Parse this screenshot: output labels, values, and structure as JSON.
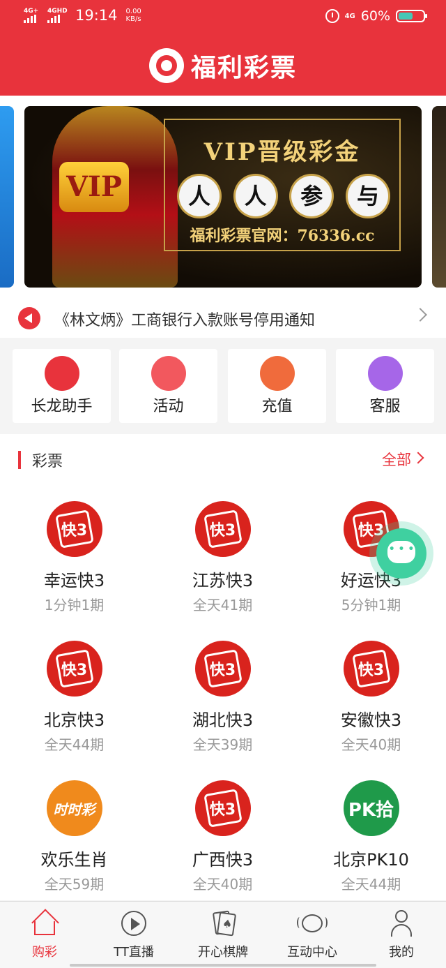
{
  "status_bar": {
    "signal1": "4G+",
    "signal2": "4GHD",
    "time": "19:14",
    "speed_value": "0.00",
    "speed_unit": "KB/s",
    "network": "4G",
    "battery": "60%"
  },
  "header": {
    "title": "福利彩票"
  },
  "banner": {
    "vip_badge": "VIP",
    "title": "VIP晋级彩金",
    "circles": [
      "人",
      "人",
      "参",
      "与"
    ],
    "subtitle": "福利彩票官网：76336.cc"
  },
  "notice": {
    "text": "《林文炳》工商银行入款账号停用通知"
  },
  "quick_actions": [
    {
      "label": "长龙助手",
      "icon": "dragon-icon",
      "color": "#e8333c"
    },
    {
      "label": "活动",
      "icon": "gift-icon",
      "color": "#f2585e"
    },
    {
      "label": "充值",
      "icon": "wallet-icon",
      "color": "#f06b3c"
    },
    {
      "label": "客服",
      "icon": "headset-icon",
      "color": "#a666e8"
    }
  ],
  "lottery_section": {
    "title": "彩票",
    "all_label": "全部",
    "games": [
      {
        "name": "幸运快3",
        "schedule": "1分钟1期",
        "icon": "k3-icon",
        "icon_text": "快3"
      },
      {
        "name": "江苏快3",
        "schedule": "全天41期",
        "icon": "k3-icon",
        "icon_text": "快3"
      },
      {
        "name": "好运快3",
        "schedule": "5分钟1期",
        "icon": "k3-icon",
        "icon_text": "快3"
      },
      {
        "name": "北京快3",
        "schedule": "全天44期",
        "icon": "k3-icon",
        "icon_text": "快3"
      },
      {
        "name": "湖北快3",
        "schedule": "全天39期",
        "icon": "k3-icon",
        "icon_text": "快3"
      },
      {
        "name": "安徽快3",
        "schedule": "全天40期",
        "icon": "k3-icon",
        "icon_text": "快3"
      },
      {
        "name": "欢乐生肖",
        "schedule": "全天59期",
        "icon": "shishicai-icon",
        "icon_text": "时时彩"
      },
      {
        "name": "广西快3",
        "schedule": "全天40期",
        "icon": "k3-icon",
        "icon_text": "快3"
      },
      {
        "name": "北京PK10",
        "schedule": "全天44期",
        "icon": "pk10-icon",
        "icon_text": "PK拾"
      }
    ]
  },
  "tabbar": {
    "tabs": [
      {
        "label": "购彩",
        "icon": "home-icon",
        "active": true
      },
      {
        "label": "TT直播",
        "icon": "play-icon",
        "active": false
      },
      {
        "label": "开心棋牌",
        "icon": "cards-icon",
        "active": false
      },
      {
        "label": "互动中心",
        "icon": "chat-icon",
        "active": false
      },
      {
        "label": "我的",
        "icon": "user-icon",
        "active": false
      }
    ]
  },
  "colors": {
    "brand_red": "#e8333c",
    "chat_green": "#3fd0a0"
  }
}
